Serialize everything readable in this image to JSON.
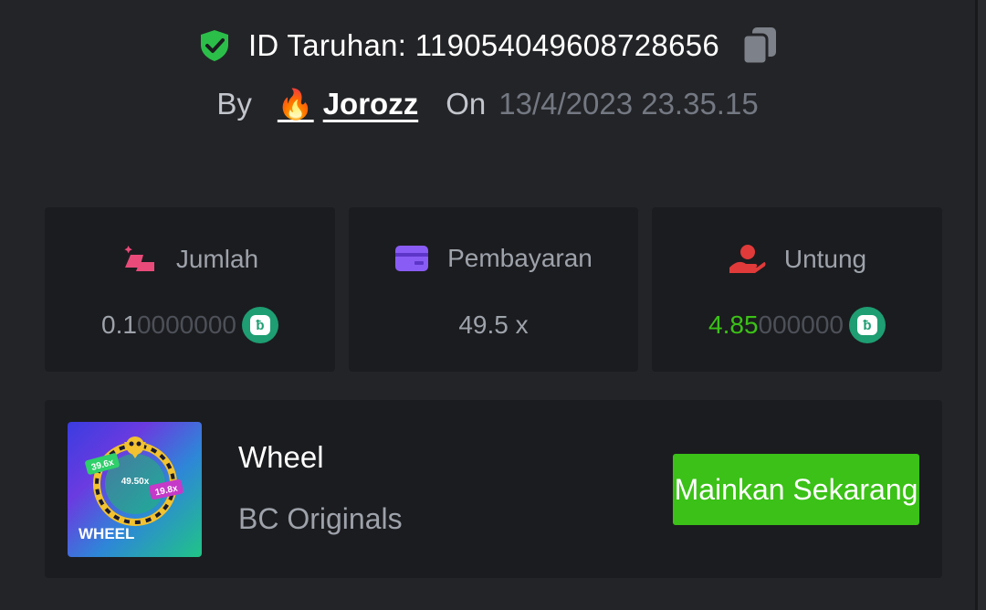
{
  "header": {
    "bet_id_label": "ID Taruhan: 119054049608728656",
    "by_label": "By",
    "username": "Jorozz",
    "on_label": "On",
    "date": "13/4/2023 23.35.15"
  },
  "stats": [
    {
      "label": "Jumlah",
      "value_main": "0.1",
      "value_dim": "0000000",
      "currency_icon": "bc-coin-icon"
    },
    {
      "label": "Pembayaran",
      "value": "49.5 x"
    },
    {
      "label": "Untung",
      "value_main": "4.85",
      "value_dim": "000000",
      "currency_icon": "bc-coin-icon"
    }
  ],
  "game": {
    "name": "Wheel",
    "provider": "BC Originals",
    "play_label": "Mainkan Sekarang",
    "thumb_title": "WHEEL",
    "thumb_multipliers": [
      "39.6x",
      "49.50x",
      "19.8x"
    ]
  },
  "colors": {
    "background": "#232427",
    "card": "#1b1c1f",
    "accent_green": "#3bc117",
    "profit_green": "#3bc117",
    "coin": "#1e9e72",
    "jumlah_icon": "#e84b7a",
    "pembayaran_icon": "#8a5cf6",
    "untung_icon": "#e03a3a"
  }
}
